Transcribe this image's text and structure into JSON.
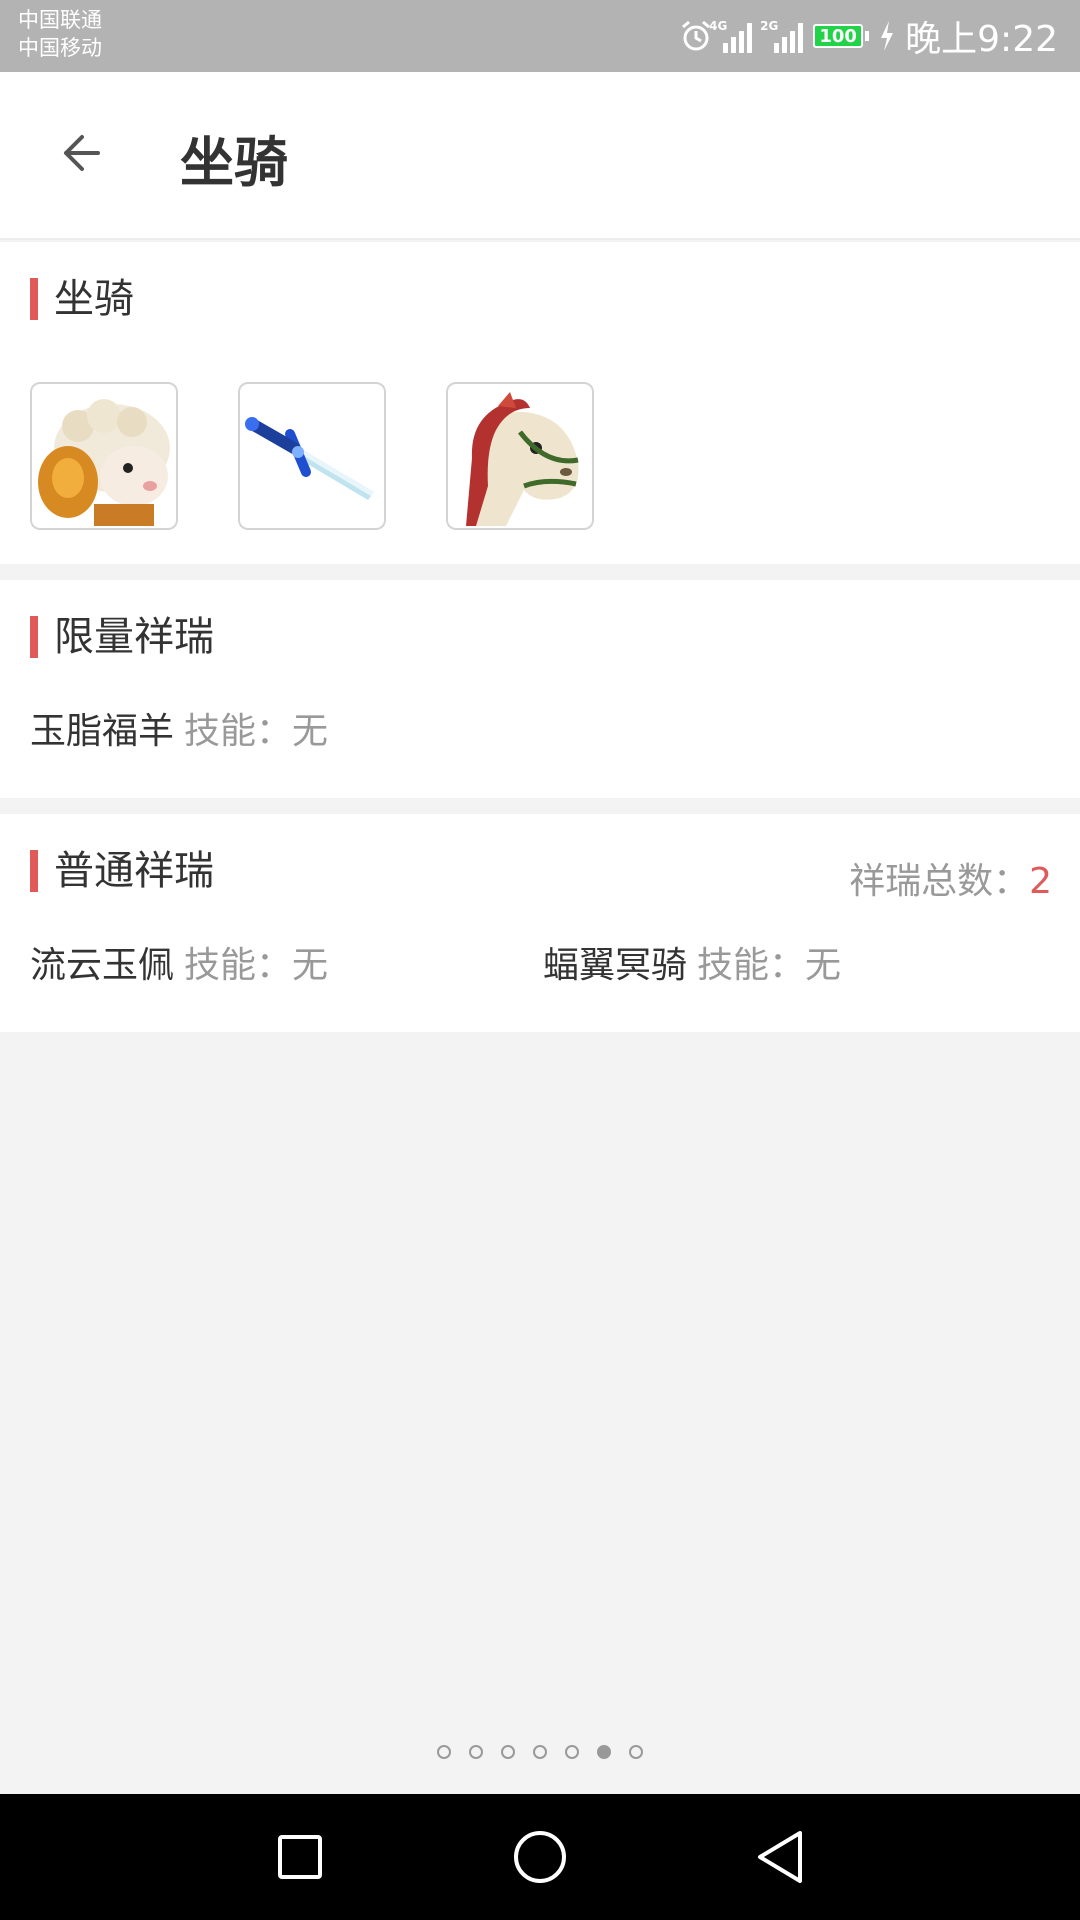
{
  "status_bar": {
    "carrier_1": "中国联通",
    "carrier_2": "中国移动",
    "network_1": "4G",
    "network_2": "2G",
    "battery": "100",
    "time": "晚上9:22",
    "icons": [
      "alarm-icon",
      "signal-icon",
      "battery-icon",
      "charging-icon"
    ]
  },
  "header": {
    "back_icon": "arrow-left-icon",
    "title": "坐骑"
  },
  "mounts_section": {
    "title": "坐骑",
    "mounts": [
      {
        "icon": "sheep-mount-icon"
      },
      {
        "icon": "sword-mount-icon"
      },
      {
        "icon": "horse-mount-icon"
      }
    ]
  },
  "limited_section": {
    "title": "限量祥瑞",
    "items": [
      {
        "name": "玉脂福羊",
        "skill": "技能：无"
      }
    ]
  },
  "normal_section": {
    "title": "普通祥瑞",
    "total_label": "祥瑞总数：",
    "total_value": "2",
    "items": [
      {
        "name": "流云玉佩",
        "skill": "技能：无"
      },
      {
        "name": "蝠翼冥骑",
        "skill": "技能：无"
      }
    ]
  },
  "pager": {
    "page_count": 7,
    "active_page": 6
  },
  "nav_bar": {
    "icons": [
      "recent-apps-icon",
      "home-icon",
      "back-icon"
    ]
  },
  "colors": {
    "accent": "#e05a5a",
    "status_bar": "#b3b3b3",
    "battery": "#22d34a"
  }
}
